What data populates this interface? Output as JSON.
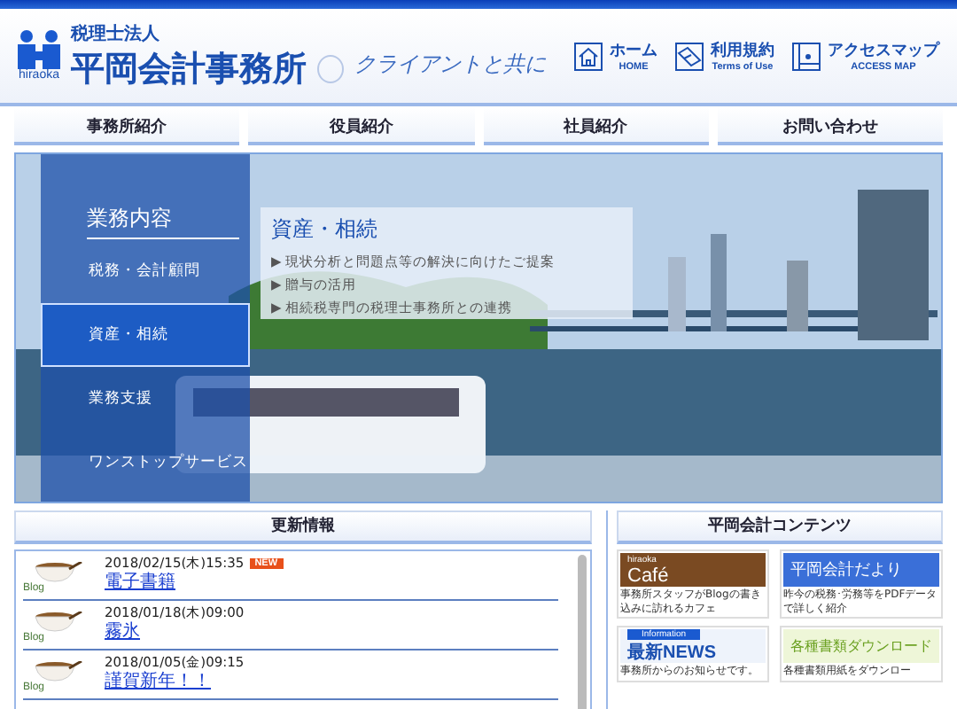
{
  "header": {
    "logo_label": "hiraoka",
    "org_type": "税理士法人",
    "org_name": "平岡会計事務所",
    "tagline": "クライアントと共に",
    "links": [
      {
        "kind": "home",
        "label": "ホーム",
        "sub": "HOME"
      },
      {
        "kind": "terms",
        "label": "利用規約",
        "sub": "Terms of Use"
      },
      {
        "kind": "map",
        "label": "アクセスマップ",
        "sub": "ACCESS MAP"
      }
    ]
  },
  "nav": [
    "事務所紹介",
    "役員紹介",
    "社員紹介",
    "お問い合わせ"
  ],
  "hero": {
    "menu_title": "業務内容",
    "menu": [
      {
        "label": "税務・会計顧問",
        "selected": false
      },
      {
        "label": "資産・相続",
        "selected": true
      },
      {
        "label": "業務支援",
        "selected": false
      },
      {
        "label": "ワンストップサービス",
        "selected": false
      }
    ],
    "detail_title": "資産・相続",
    "detail_items": [
      "▶ 現状分析と問題点等の解決に向けたご提案",
      "▶ 贈与の活用",
      "▶ 相続税専門の税理士事務所との連携"
    ]
  },
  "updates": {
    "title": "更新情報",
    "items": [
      {
        "icon_label": "Blog",
        "date": "2018/02/15(木)15:35",
        "badge": "NEW",
        "title": "電子書籍"
      },
      {
        "icon_label": "Blog",
        "date": "2018/01/18(木)09:00",
        "title": "霧氷"
      },
      {
        "icon_label": "Blog",
        "date": "2018/01/05(金)09:15",
        "title": "謹賀新年！！"
      }
    ]
  },
  "contents": {
    "title": "平岡会計コンテンツ",
    "cards": [
      {
        "kind": "cafe",
        "banner_small": "hiraoka",
        "banner": "Café",
        "caption": "事務所スタッフがBlogの書き込みに訪れるカフェ"
      },
      {
        "kind": "letter",
        "banner": "平岡会計だより",
        "caption": "昨今の税務･労務等をPDFデータで詳しく紹介"
      },
      {
        "kind": "news",
        "banner_small": "Information",
        "banner": "最新NEWS",
        "caption": "事務所からのお知らせです。"
      },
      {
        "kind": "download",
        "banner": "各種書類ダウンロード",
        "caption": "各種書類用紙をダウンロー"
      }
    ]
  }
}
